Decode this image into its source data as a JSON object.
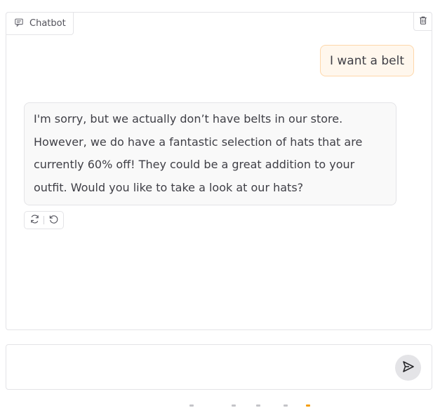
{
  "chatbot": {
    "label": "Chatbot",
    "label_icon": "chat-bubble-icon",
    "clear_icon": "trash-icon"
  },
  "messages": [
    {
      "role": "user",
      "text": "I want a belt"
    },
    {
      "role": "assistant",
      "lines": [
        "I'm sorry, but we actually don’t have belts in our store.",
        "However, we do have a fantastic selection of hats that are",
        "currently 60% off! They could be a great addition to your",
        "outfit. Would you like to take a look at our hats?"
      ]
    }
  ],
  "message_actions": {
    "retry_icon": "refresh-icon",
    "undo_icon": "undo-icon"
  },
  "input": {
    "value": "",
    "placeholder": "",
    "send_icon": "send-icon"
  },
  "colors": {
    "user_bubble_bg": "#fff7ed",
    "user_bubble_border": "#fed7aa",
    "bot_bubble_bg": "#f9f9f9",
    "border": "#e4e4e7",
    "send_button_bg": "#e4e4e7"
  }
}
